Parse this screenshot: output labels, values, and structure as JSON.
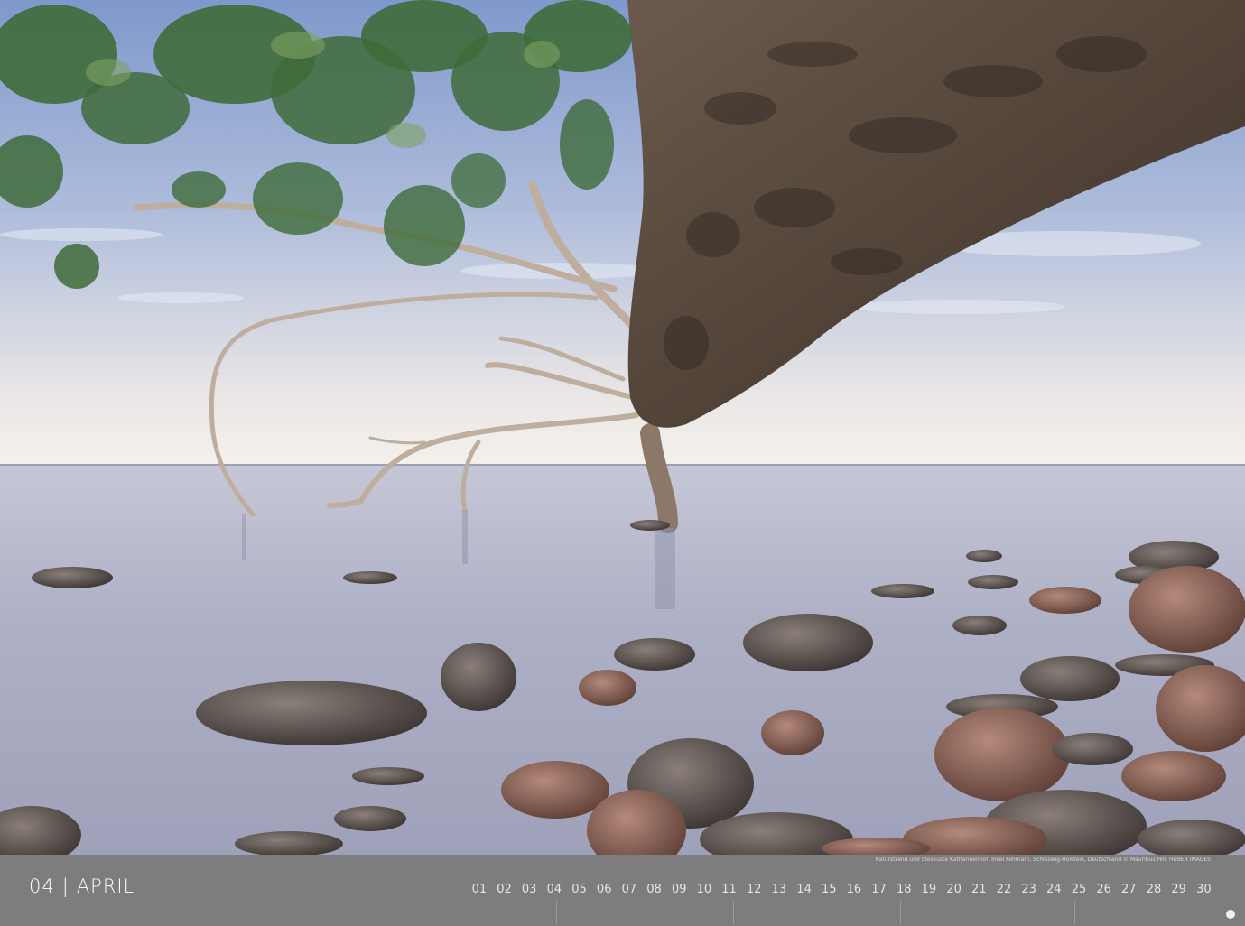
{
  "calendar": {
    "month_number": "04",
    "separator": "|",
    "month_name": "APRIL",
    "credit": "Naturstrand und Steilküste Katharinenhof, Insel Fehmarn, Schleswig-Holstein, Deutschland © Mauritius Hill, HUBER IMAGES",
    "days": [
      "01",
      "02",
      "03",
      "04",
      "05",
      "06",
      "07",
      "08",
      "09",
      "10",
      "11",
      "12",
      "13",
      "14",
      "15",
      "16",
      "17",
      "18",
      "19",
      "20",
      "21",
      "22",
      "23",
      "24",
      "25",
      "26",
      "27",
      "28",
      "29",
      "30"
    ]
  },
  "colors": {
    "bar": "#7d7d7d",
    "sky_top": "#8fa6d3",
    "sky_horizon": "#f3f1ee",
    "water": "#b5b7cc",
    "trunk": "#5b4c40",
    "leaves": "#3f6b3a"
  }
}
